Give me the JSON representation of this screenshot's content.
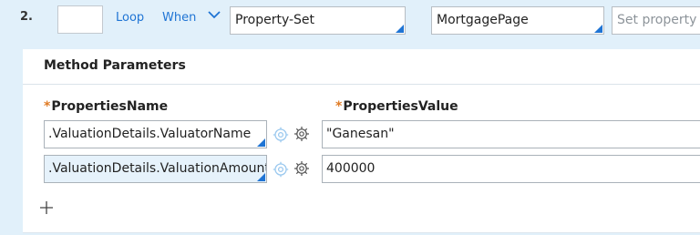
{
  "step": {
    "number": "2.",
    "label_value": "",
    "loop_link": "Loop",
    "when_link": "When",
    "method_value": "Property-Set",
    "page_value": "MortgagePage",
    "description_placeholder": "Set property v"
  },
  "method_parameters": {
    "title": "Method Parameters",
    "columns": {
      "name_header": "PropertiesName",
      "value_header": "PropertiesValue",
      "required_marker": "*"
    },
    "rows": [
      {
        "name": ".ValuationDetails.ValuatorName",
        "value": "\"Ganesan\""
      },
      {
        "name": ".ValuationDetails.ValuationAmount",
        "value": "400000"
      }
    ]
  },
  "colors": {
    "accent": "#1f74d4",
    "required": "#e07b24",
    "panel_bg": "#e1f0fa"
  },
  "icons": [
    "chevron-down-icon",
    "target-icon",
    "gear-icon",
    "add-icon"
  ]
}
